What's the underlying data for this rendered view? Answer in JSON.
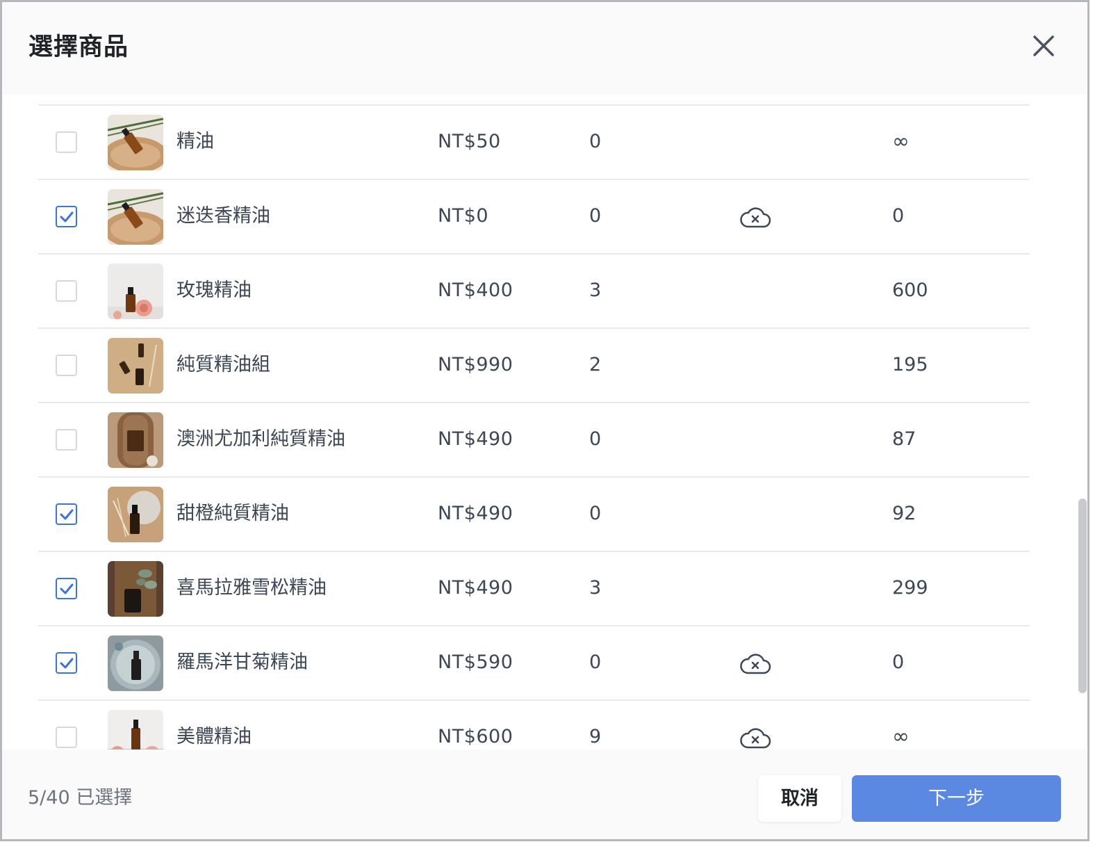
{
  "modal": {
    "title": "選擇商品",
    "close_icon": "close-icon"
  },
  "products": [
    {
      "name": "精油",
      "price": "NT$50",
      "qty": "0",
      "cloud": false,
      "stock": "∞",
      "checked": false,
      "image": "oil-bottle-on-wood"
    },
    {
      "name": "迷迭香精油",
      "price": "NT$0",
      "qty": "0",
      "cloud": true,
      "stock": "0",
      "checked": true,
      "image": "oil-bottle-on-wood"
    },
    {
      "name": "玫瑰精油",
      "price": "NT$400",
      "qty": "3",
      "cloud": false,
      "stock": "600",
      "checked": false,
      "image": "bottle-with-rose"
    },
    {
      "name": "純質精油組",
      "price": "NT$990",
      "qty": "2",
      "cloud": false,
      "stock": "195",
      "checked": false,
      "image": "bottles-on-beige"
    },
    {
      "name": "澳洲尤加利純質精油",
      "price": "NT$490",
      "qty": "0",
      "cloud": false,
      "stock": "87",
      "checked": false,
      "image": "bottle-on-tray"
    },
    {
      "name": "甜橙純質精油",
      "price": "NT$490",
      "qty": "0",
      "cloud": false,
      "stock": "92",
      "checked": true,
      "image": "bottle-with-dried-flowers"
    },
    {
      "name": "喜馬拉雅雪松精油",
      "price": "NT$490",
      "qty": "3",
      "cloud": false,
      "stock": "299",
      "checked": true,
      "image": "jar-with-eucalyptus"
    },
    {
      "name": "羅馬洋甘菊精油",
      "price": "NT$590",
      "qty": "0",
      "cloud": true,
      "stock": "0",
      "checked": true,
      "image": "bottle-on-plate"
    },
    {
      "name": "美體精油",
      "price": "NT$600",
      "qty": "9",
      "cloud": true,
      "stock": "∞",
      "checked": false,
      "image": "bottle-with-flowers"
    }
  ],
  "footer": {
    "selection_count": "5/40 已選擇",
    "cancel_label": "取消",
    "next_label": "下一步"
  },
  "colors": {
    "accent": "#5b89e1",
    "checkbox_checked": "#3d72d6",
    "text": "#3d4654"
  }
}
